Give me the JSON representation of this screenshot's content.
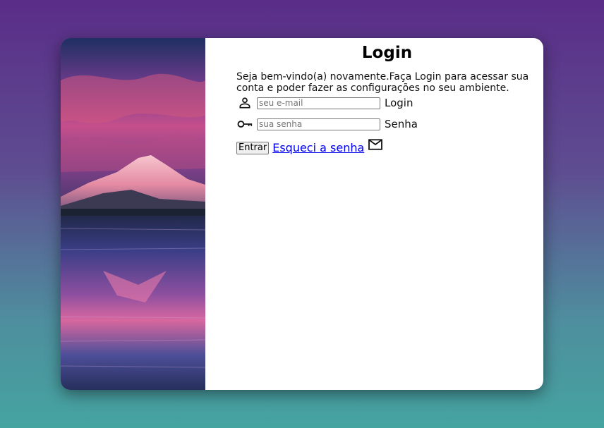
{
  "login": {
    "title": "Login",
    "intro": "Seja bem-vindo(a) novamente.Faça Login para acessar sua conta e poder fazer as configurações no seu ambiente.",
    "email": {
      "placeholder": "seu e-mail",
      "value": "",
      "label": "Login",
      "icon": "person-icon"
    },
    "password": {
      "placeholder": "sua senha",
      "value": "",
      "label": "Senha",
      "icon": "key-icon"
    },
    "submit_label": "Entrar",
    "forgot_label": "Esqueci a senha",
    "forgot_icon": "mail-icon"
  },
  "image": {
    "description_icon": "mountain-lake-photo"
  },
  "colors": {
    "background_top": "#5a2d88",
    "background_bottom": "#45a4a0",
    "card": "#ffffff",
    "link": "#0000ee"
  }
}
